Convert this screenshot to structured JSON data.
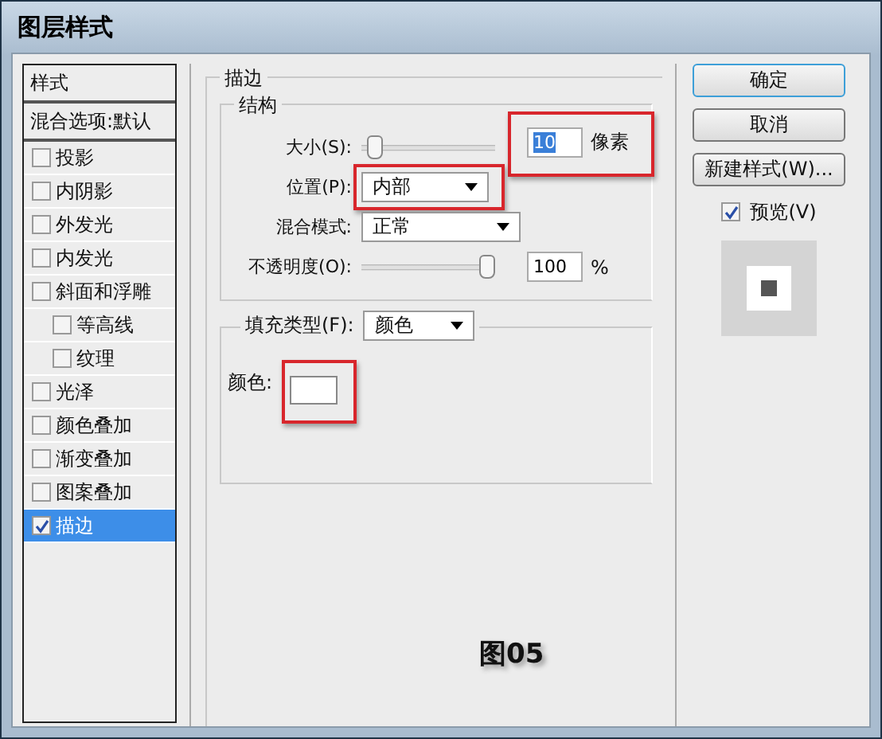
{
  "window": {
    "title": "图层样式"
  },
  "sidebar": {
    "header": "样式",
    "blend_options": "混合选项:默认",
    "items": [
      {
        "label": "投影",
        "checked": false,
        "selected": false
      },
      {
        "label": "内阴影",
        "checked": false,
        "selected": false
      },
      {
        "label": "外发光",
        "checked": false,
        "selected": false
      },
      {
        "label": "内发光",
        "checked": false,
        "selected": false
      },
      {
        "label": "斜面和浮雕",
        "checked": false,
        "selected": false,
        "children": [
          {
            "label": "等高线",
            "checked": false,
            "selected": false
          },
          {
            "label": "纹理",
            "checked": false,
            "selected": false
          }
        ]
      },
      {
        "label": "光泽",
        "checked": false,
        "selected": false
      },
      {
        "label": "颜色叠加",
        "checked": false,
        "selected": false
      },
      {
        "label": "渐变叠加",
        "checked": false,
        "selected": false
      },
      {
        "label": "图案叠加",
        "checked": false,
        "selected": false
      },
      {
        "label": "描边",
        "checked": true,
        "selected": true
      }
    ]
  },
  "stroke": {
    "title": "描边",
    "structure": {
      "title": "结构",
      "rows": [
        {
          "kind": "slider",
          "label": "大小(S):",
          "level": 0.05,
          "value": "10",
          "unit": "像素",
          "highlighted": true
        },
        {
          "kind": "select",
          "label": "位置(P):",
          "value": "内部"
        },
        {
          "kind": "select",
          "label": "混合模式:",
          "value": "正常"
        },
        {
          "kind": "slider",
          "label": "不透明度(O):",
          "level": 1,
          "value": "100",
          "unit": "%",
          "highlighted": false
        }
      ]
    },
    "fill": {
      "label": "填充类型(F):",
      "value": "颜色",
      "color_label": "颜色:",
      "color": "#ffffff"
    }
  },
  "caption": "图05",
  "buttons": [
    {
      "label": "确定",
      "default": true
    },
    {
      "label": "取消",
      "default": false
    },
    {
      "label": "新建样式(W)...",
      "default": false
    }
  ],
  "preview": {
    "label": "预览(V)",
    "checked": true
  }
}
